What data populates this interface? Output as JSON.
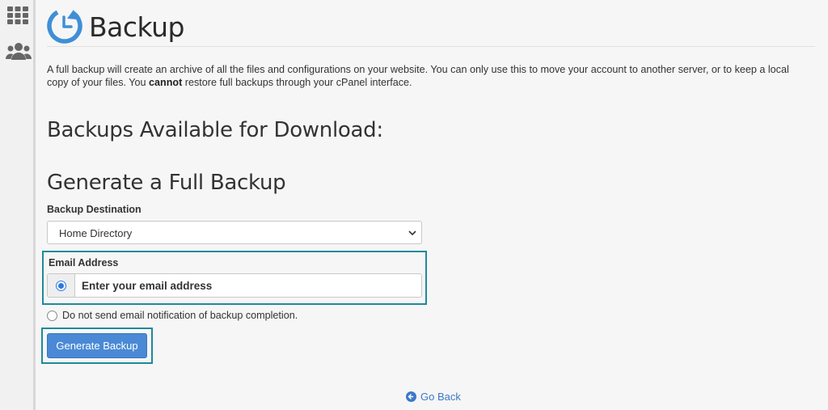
{
  "sidebar": {
    "icons": [
      "apps-grid-icon",
      "users-icon"
    ]
  },
  "header": {
    "title": "Backup",
    "icon": "backup-clock-icon"
  },
  "intro": {
    "part1": "A full backup will create an archive of all the files and configurations on your website. You can only use this to move your account to another server, or to keep a local copy of your files. You ",
    "bold": "cannot",
    "part2": " restore full backups through your cPanel interface."
  },
  "sections": {
    "available_heading": "Backups Available for Download:",
    "generate_heading": "Generate a Full Backup"
  },
  "form": {
    "destination_label": "Backup Destination",
    "destination_value": "Home Directory",
    "email_label": "Email Address",
    "email_placeholder": "Enter your email address",
    "email_value": "",
    "no_email_label": "Do not send email notification of backup completion.",
    "generate_button": "Generate Backup"
  },
  "footer": {
    "go_back": "Go Back"
  },
  "colors": {
    "accent": "#4a89d5",
    "highlight": "#1f8a99",
    "link": "#3c78c8"
  }
}
